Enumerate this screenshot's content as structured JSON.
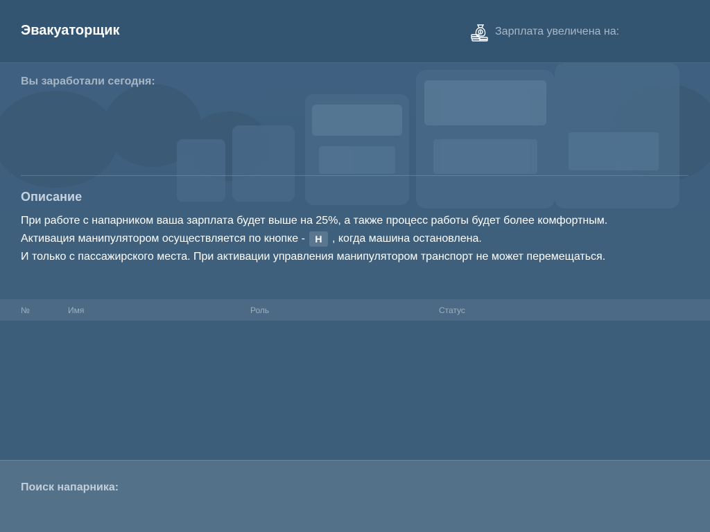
{
  "header": {
    "title": "Эвакуаторщик",
    "salary_increase_label": "Зарплата увеличена на:",
    "salary_icon": "money-bag-coins-icon"
  },
  "earnings": {
    "label": "Вы заработали сегодня:"
  },
  "description": {
    "title": "Описание",
    "line1": "При работе с напарником ваша зарплата будет выше на 25%, а также процесс работы будет более комфортным.",
    "line2_before": "Активация манипулятором осуществляется по кнопке -",
    "key": "H",
    "line2_after": ", когда машина остановлена.",
    "line3": "И только с пассажирского места. При активации управления манипулятором транспорт не может перемещаться."
  },
  "table": {
    "columns": [
      "№",
      "Имя",
      "Роль",
      "Статус"
    ],
    "rows": []
  },
  "footer": {
    "search_label": "Поиск напарника:"
  },
  "colors": {
    "background": "#3d5e7b",
    "header": "#335571",
    "table_header": "#4c6a85",
    "footer": "#537188",
    "key_badge": "#5b7790"
  }
}
